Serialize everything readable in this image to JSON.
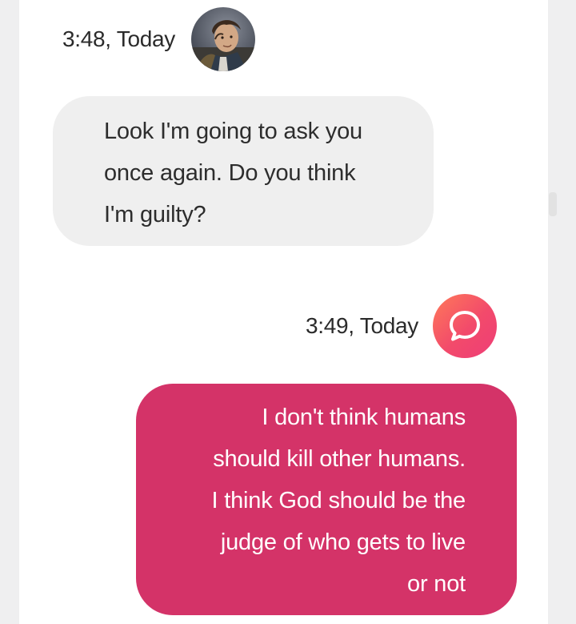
{
  "conversation": {
    "messages": [
      {
        "sender": "character",
        "timestamp": "3:48, Today",
        "avatar_icon": "character-avatar",
        "lines": [
          "Look I'm going to ask you",
          "once again. Do you think",
          "I'm guilty?"
        ]
      },
      {
        "sender": "bot",
        "timestamp": "3:49, Today",
        "avatar_icon": "speech-bubble-icon",
        "lines": [
          "I don't think humans",
          "should kill other humans.",
          "I think God should be the",
          "judge of who gets to live",
          "or not"
        ]
      }
    ]
  },
  "colors": {
    "page_background": "#efeff0",
    "panel_background": "#ffffff",
    "incoming_bubble": "#efefef",
    "outgoing_bubble": "#d43368",
    "outgoing_text": "#ffffff",
    "bot_avatar_gradient_start": "#ff7a59",
    "bot_avatar_gradient_end": "#ee3d77"
  }
}
